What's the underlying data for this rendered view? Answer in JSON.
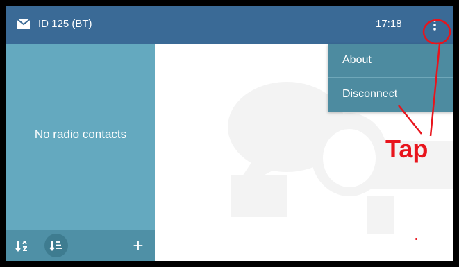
{
  "appbar": {
    "title": "ID 125 (BT)",
    "time": "17:18",
    "icons": {
      "mail": "mail-icon",
      "overflow": "more-vert-icon"
    }
  },
  "sidebar": {
    "empty_text": "No radio contacts",
    "toolbar": {
      "sort_alpha_icon": "sort-alphabetical-icon",
      "sort_list_icon": "sort-list-icon",
      "add_label": "+"
    }
  },
  "menu": {
    "items": [
      {
        "label": "About"
      },
      {
        "label": "Disconnect"
      }
    ]
  },
  "annotation": {
    "callout_text": "Tap",
    "color": "#e8141c"
  },
  "colors": {
    "appbar": "#3a6a96",
    "sidebar": "#64a9bf",
    "sidebar_toolbar": "#4f90a6",
    "menu": "#4d8ba0",
    "frame": "#000000"
  }
}
